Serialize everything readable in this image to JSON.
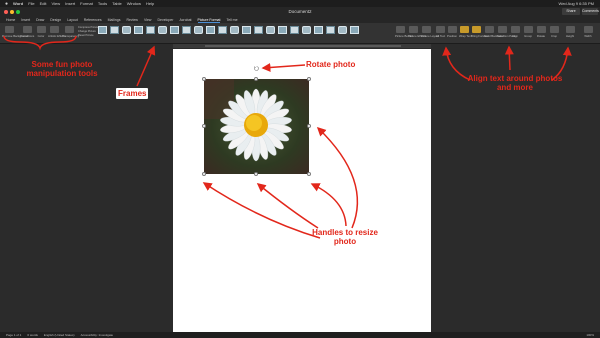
{
  "menubar": {
    "apple": "",
    "app_name": "Word",
    "items": [
      "File",
      "Edit",
      "View",
      "Insert",
      "Format",
      "Tools",
      "Table",
      "Window",
      "Help"
    ],
    "clock": "Wed Aug 9  6:35 PM"
  },
  "window": {
    "title": "Document2",
    "share_label": "Share",
    "comments_label": "Comments",
    "traffic_colors": [
      "#ff5f57",
      "#febc2e",
      "#28c840"
    ]
  },
  "ribbon_tabs": {
    "items": [
      "Home",
      "Insert",
      "Draw",
      "Design",
      "Layout",
      "References",
      "Mailings",
      "Review",
      "View",
      "Developer",
      "Acrobat",
      "Picture Format",
      "Tell me"
    ],
    "active_index": 11
  },
  "ribbon": {
    "left_buttons": [
      "Remove Background",
      "Corrections",
      "Color",
      "Artistic Effects",
      "Transparency"
    ],
    "adjust_items": [
      "Compress Pictures",
      "Change Picture",
      "Reset Picture"
    ],
    "right_buttons": [
      "Picture Border",
      "Picture Effects",
      "Picture Layout",
      "Alt Text",
      "Position",
      "Wrap Text",
      "Bring Forward",
      "Send Backward",
      "Selection Pane",
      "Align",
      "Group",
      "Rotate",
      "Crop",
      "Height",
      "Width"
    ],
    "gallery_count": 22
  },
  "statusbar": {
    "page": "Page 1 of 1",
    "words": "0 words",
    "language": "English (United States)",
    "accessibility": "Accessibility: Investigate",
    "zoom": "100%"
  },
  "annotations": {
    "photo_tools": "Some fun photo manipulation tools",
    "frames": "Frames",
    "rotate": "Rotate photo",
    "align": "Align text around photos and more",
    "handles": "Handles to resize photo"
  },
  "colors": {
    "annotation": "#e2271b",
    "accent": "#4b8fd6",
    "petal": "#f4f4f4",
    "center": "#f2b705"
  }
}
